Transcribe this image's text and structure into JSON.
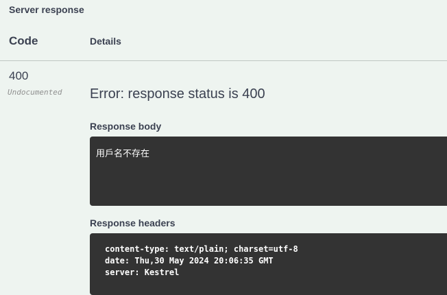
{
  "section_title": "Server response",
  "columns": {
    "code": "Code",
    "details": "Details"
  },
  "response": {
    "status_code": "400",
    "status_note": "Undocumented",
    "error_message": "Error: response status is 400",
    "body_label": "Response body",
    "body_text": "用戶名不存在",
    "headers_label": "Response headers",
    "headers": [
      "content-type: text/plain; charset=utf-8",
      "date: Thu,30 May 2024 20:06:35 GMT",
      "server: Kestrel"
    ]
  }
}
